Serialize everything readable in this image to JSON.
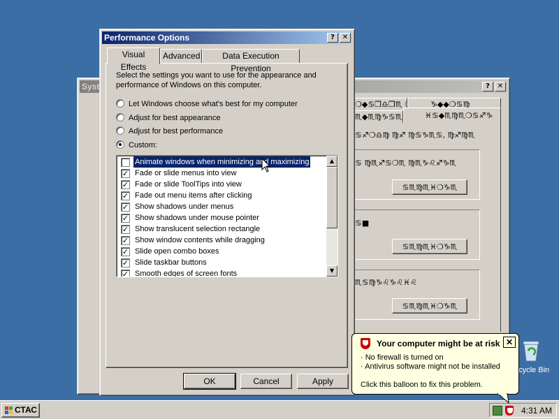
{
  "perf": {
    "title": "Performance Options",
    "tabs": [
      "Visual Effects",
      "Advanced",
      "Data Execution Prevention"
    ],
    "description": "Select the settings you want to use for the appearance and performance of Windows on this computer.",
    "radios": [
      {
        "label": "Let Windows choose what's best for my computer",
        "selected": false
      },
      {
        "label": "Adjust for best appearance",
        "selected": false
      },
      {
        "label": "Adjust for best performance",
        "selected": false
      },
      {
        "label": "Custom:",
        "selected": true
      }
    ],
    "effects": [
      {
        "label": "Animate windows when minimizing and maximizing",
        "checked": false
      },
      {
        "label": "Fade or slide menus into view",
        "checked": true
      },
      {
        "label": "Fade or slide ToolTips into view",
        "checked": true
      },
      {
        "label": "Fade out menu items after clicking",
        "checked": true
      },
      {
        "label": "Show shadows under menus",
        "checked": true
      },
      {
        "label": "Show shadows under mouse pointer",
        "checked": true
      },
      {
        "label": "Show translucent selection rectangle",
        "checked": true
      },
      {
        "label": "Show window contents while dragging",
        "checked": true
      },
      {
        "label": "Slide open combo boxes",
        "checked": true
      },
      {
        "label": "Slide taskbar buttons",
        "checked": true
      },
      {
        "label": "Smooth edges of screen fonts",
        "checked": true
      }
    ],
    "ok_label": "OK",
    "cancel_label": "Cancel",
    "apply_label": "Apply"
  },
  "system": {
    "title": "Syst",
    "tab_a": "❍◆♋❒♎❒♏ ❍♋",
    "tab_b": "♑◆◆❍♋♍",
    "tab_c": "♏◆♏♍♑♋♏",
    "tab_d": "♓♋◆♏♍♏❍♋♐♑",
    "section_text": "♋♐❍♎♍ ♍♐ ♍♋♑♏♋, ♍♐♍♏",
    "group1_text": "♋ ♍♏♐♋❍♏ ♍♏♑♌♐♑♏",
    "group2_text": "♋■",
    "group3_text": "♏♋♍♑♌♑♌♓♌",
    "settings_label": "♋♏♍♏♓❍♑♏"
  },
  "balloon": {
    "title": "Your computer might be at risk",
    "line1": "· No firewall is turned on",
    "line2": "· Antivirus software might not be installed",
    "footer": "Click this balloon to fix this problem."
  },
  "desktop": {
    "recycle_label": "ecycle Bin"
  },
  "taskbar": {
    "start_label": "СТАС",
    "clock": "4:31 AM"
  },
  "colors": {
    "desktop": "#3a6ea5",
    "title_active": "#0a246a",
    "face": "#d4d0c8",
    "balloon": "#ffffe1"
  }
}
